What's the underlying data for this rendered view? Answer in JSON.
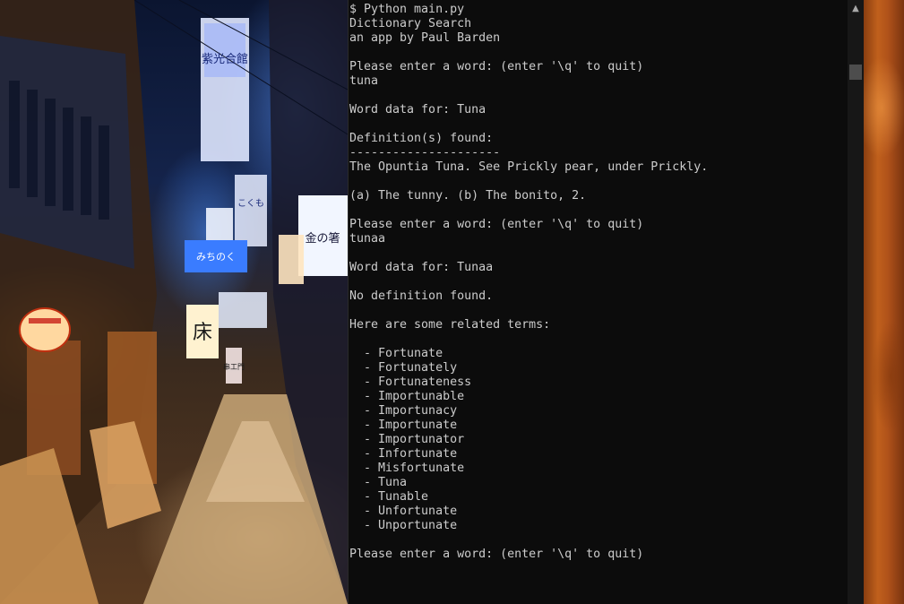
{
  "console": {
    "lines": [
      "$ Python main.py",
      "Dictionary Search",
      "an app by Paul Barden",
      "",
      "Please enter a word: (enter '\\q' to quit)",
      "tuna",
      "",
      "Word data for: Tuna",
      "",
      "Definition(s) found:",
      "---------------------",
      "The Opuntia Tuna. See Prickly pear, under Prickly.",
      "",
      "(a) The tunny. (b) The bonito, 2.",
      "",
      "Please enter a word: (enter '\\q' to quit)",
      "tunaa",
      "",
      "Word data for: Tunaa",
      "",
      "No definition found.",
      "",
      "Here are some related terms:",
      "",
      "  - Fortunate",
      "  - Fortunately",
      "  - Fortunateness",
      "  - Importunable",
      "  - Importunacy",
      "  - Importunate",
      "  - Importunator",
      "  - Infortunate",
      "  - Misfortunate",
      "  - Tuna",
      "  - Tunable",
      "  - Unfortunate",
      "  - Unportunate",
      "",
      "Please enter a word: (enter '\\q' to quit)"
    ]
  },
  "scrollbar": {
    "up_arrow_glyph": "▲",
    "up_arrow_icon": "scroll-up-arrow-icon"
  },
  "wallpaper": {
    "left_sign_1": "紫光合館",
    "left_sign_2": "こくも",
    "left_sign_3": "みちのく",
    "left_sign_4": "金の箸",
    "left_sign_5": "床",
    "left_sign_6": "串工門"
  },
  "colors": {
    "console_background": "#0c0c0c",
    "console_text": "#cccccc",
    "scrollbar_track": "#171717",
    "scrollbar_thumb": "#4d4d4d"
  }
}
